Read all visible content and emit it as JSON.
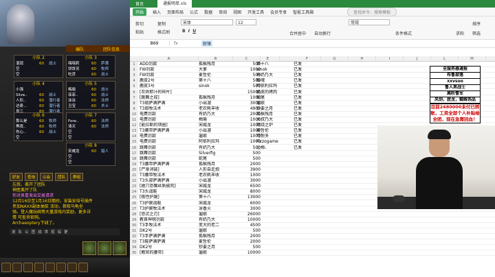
{
  "game": {
    "party_header": [
      "编队",
      "团队信息"
    ],
    "groups": [
      {
        "title": "小队 2",
        "rows": [
          [
            "混现",
            "60",
            "战士"
          ],
          [
            "空",
            "",
            ""
          ],
          [
            "空",
            "",
            ""
          ]
        ]
      },
      {
        "title": "小队 3",
        "rows": [
          [
            "嗨嗨莉",
            "60",
            "萨满"
          ],
          [
            "饼饼灵",
            "60",
            "牧师"
          ],
          [
            "吃货",
            "60",
            "战士"
          ]
        ]
      },
      {
        "title": "小队 4",
        "rows": [
          [
            "小强",
            "",
            ""
          ],
          [
            "Slive..",
            "60",
            "战士"
          ],
          [
            "人形..",
            "60",
            "潜行者"
          ],
          [
            "达奇...",
            "60",
            "潜行者"
          ],
          [
            "良三",
            "60",
            "潜行者"
          ]
        ]
      },
      {
        "title": "小队 5",
        "rows": [
          [
            "梅瑜",
            "60",
            "战士"
          ],
          [
            "菲菲..",
            "60",
            "战士"
          ],
          [
            "泳泳",
            "60",
            "法师"
          ],
          [
            "丑宝",
            "60",
            "术士"
          ]
        ]
      },
      {
        "title": "小队 6",
        "rows": [
          [
            "那么是",
            "60",
            "牧师"
          ],
          [
            "黑夜..",
            "60",
            "牧师"
          ],
          [
            "伤心..",
            "60",
            "战士"
          ],
          [
            "空",
            "",
            ""
          ]
        ]
      },
      {
        "title": "小队 7",
        "rows": [
          [
            "Fore..",
            "60",
            "法师"
          ],
          [
            "清天",
            "60",
            "法师"
          ],
          [
            "空",
            "",
            ""
          ],
          [
            "空",
            "",
            ""
          ]
        ]
      },
      {
        "title": "小队 8",
        "rows": [
          [
            "宋威龙",
            "60",
            "猎人"
          ],
          [
            "空",
            "",
            ""
          ],
          [
            "空",
            "",
            ""
          ]
        ]
      }
    ],
    "tabs": [
      "好友",
      "查询",
      "公会",
      "团队",
      "群组"
    ],
    "chat": [
      "忘我、离开了团队",
      "神医离开了队",
      "你对泉喜发出交易请求",
      "12月16日至1月16日期间，安装安培号插件",
      "参加NAXX副本抽奖 活动，首取马龟坐",
      "骑。登入魔玩碗等大量游戏内奖励，更多详",
      "情 可查询官网。",
      "Archaeoptery下线了。"
    ],
    "actionbar": [
      "说",
      "队",
      "公",
      "团",
      "战",
      "世",
      "招",
      "综",
      "更"
    ]
  },
  "excel": {
    "title_tab": "通报明单.xls",
    "home": "首页",
    "menu": [
      "开始",
      "插入",
      "页面布局",
      "公式",
      "数据",
      "审阅",
      "视图",
      "开发工具",
      "会员专享",
      "智能工具箱"
    ],
    "search": "查找命令、搜索模板",
    "ribbon": {
      "paste": "粘贴",
      "cut": "剪切",
      "copy": "复制",
      "format_painter": "格式刷",
      "font": "宋体",
      "size": "12",
      "merge": "合并居中",
      "wrap": "自动换行",
      "number_format": "常规",
      "conditional": "条件格式",
      "sum": "求和",
      "filter": "筛选",
      "sort": "排序"
    },
    "cell_ref": "B69",
    "fx": "fx",
    "formula_value": "斩锋",
    "columns": [
      "A",
      "B",
      "C",
      "D",
      "E",
      "F",
      "G",
      "H",
      "I",
      "J",
      "K",
      "L",
      "M"
    ],
    "rows": [
      {
        "n": "1",
        "a": "ADD罚款",
        "b": "孤枫残月",
        "c": "500",
        "e": "第十八",
        "f": "已发"
      },
      {
        "n": "2",
        "a": "FW罚款",
        "b": "大爹",
        "c": "1000",
        "e": "sinok",
        "f": "已发"
      },
      {
        "n": "3",
        "a": "FW罚款",
        "b": "麦哲伦",
        "c": "500",
        "e": "有奶乃大",
        "f": "已发"
      },
      {
        "n": "4",
        "a": "鹿皮2号",
        "b": "第十八",
        "c": "500",
        "e": "暖魂",
        "f": "已发"
      },
      {
        "n": "5",
        "a": "鹿皮3号",
        "b": "sinok",
        "c": "500",
        "e": "阿依利拉玛",
        "f": "已发"
      },
      {
        "n": "6",
        "a": "[灰烬耶汁的碎片]",
        "b": "",
        "c": "15000",
        "e": "脆皮的烤肉",
        "f": "已发"
      },
      {
        "n": "7",
        "a": "[跳舞之戒]",
        "b": "孤枫残月",
        "c": "1000",
        "e": "蛇尾",
        "f": "已发"
      },
      {
        "n": "8",
        "a": "T3肩萨满萨满",
        "b": "小出溜",
        "c": "3000",
        "e": "遛歌",
        "f": "已发"
      },
      {
        "n": "9",
        "a": "T3肩牧法术",
        "b": "老农耗丰收",
        "c": "4900",
        "e": "钞要之月",
        "f": "已发"
      },
      {
        "n": "10",
        "a": "电费罚款",
        "b": "有奶乃大",
        "c": "2000",
        "e": "孤枫残月",
        "f": "已发"
      },
      {
        "n": "11",
        "a": "电费罚款",
        "b": "梅瑜",
        "c": "1000",
        "e": "大叔乃大",
        "f": "已发"
      },
      {
        "n": "12",
        "a": "[能拉斯的项圈]",
        "b": "宋威龙",
        "c": "1000",
        "e": "燃烧之炉",
        "f": "已发"
      },
      {
        "n": "13",
        "a": "T3腰带萨满萨满",
        "b": "小出溜",
        "c": "1000",
        "e": "麦哲伦",
        "f": "已发"
      },
      {
        "n": "14",
        "a": "电费罚款",
        "b": "遛歌",
        "c": "1000",
        "e": "可耐多",
        "f": "已发"
      },
      {
        "n": "15",
        "a": "电费罚款",
        "b": "阿依利拉玛",
        "c": "1000",
        "e": "Fizzogame",
        "f": "已发"
      },
      {
        "n": "16",
        "a": "跳舞罚款",
        "b": "有奶乃大",
        "c": "500",
        "e": "尐梅、",
        "f": "已发"
      },
      {
        "n": "17",
        "a": "跳舞罚款",
        "b": "Silverfig",
        "c": "500",
        "e": "",
        "f": ""
      },
      {
        "n": "18",
        "a": "跳舞罚款",
        "b": "蛇尾",
        "c": "500",
        "e": "",
        "f": ""
      },
      {
        "n": "19",
        "a": "T3腰带萨满萨满",
        "b": "孤枫残月",
        "c": "2000",
        "e": "",
        "f": ""
      },
      {
        "n": "20",
        "a": "[尸身消链]",
        "b": "人形自走炮",
        "c": "3900",
        "e": "",
        "f": ""
      },
      {
        "n": "21",
        "a": "T3腰带牧法术",
        "b": "老农耗丰收",
        "c": "1000",
        "e": "",
        "f": ""
      },
      {
        "n": "22",
        "a": "T3头部萨满萨满",
        "b": "小出溜",
        "c": "3000",
        "e": "",
        "f": ""
      },
      {
        "n": "23",
        "a": "[她穴恐魔丝质披风]",
        "b": "宋威龙",
        "c": "6500",
        "e": "",
        "f": ""
      },
      {
        "n": "24",
        "a": "T3头战鞋",
        "b": "宋威龙",
        "c": "8000",
        "e": "",
        "f": ""
      },
      {
        "n": "25",
        "a": "[极性护腿]",
        "b": "第十八",
        "c": "13000",
        "e": "",
        "f": ""
      },
      {
        "n": "26",
        "a": "T3护腕战鞋",
        "b": "宋威龙",
        "c": "6000",
        "e": "",
        "f": ""
      },
      {
        "n": "27",
        "a": "T3护腕牧法术",
        "b": "泳香火",
        "c": "3000",
        "e": "",
        "f": ""
      },
      {
        "n": "28",
        "a": "[恐灵之刃]",
        "b": "遛歌",
        "c": "26000",
        "e": "",
        "f": ""
      },
      {
        "n": "29",
        "a": "教首神桃罚款",
        "b": "有奶乃大",
        "c": "10000",
        "e": "",
        "f": ""
      },
      {
        "n": "30",
        "a": "T3手牧法术",
        "b": "变大的老二",
        "c": "4500",
        "e": "",
        "f": ""
      },
      {
        "n": "31",
        "a": "DK2号",
        "b": "遛歌",
        "c": "500",
        "e": "",
        "f": ""
      },
      {
        "n": "32",
        "a": "T3手萨满萨满",
        "b": "孤枫残月",
        "c": "2000",
        "e": "",
        "f": ""
      },
      {
        "n": "33",
        "a": "T3鞋萨满萨满",
        "b": "麦哲伦",
        "c": "2000",
        "e": "",
        "f": ""
      },
      {
        "n": "34",
        "a": "DK2号",
        "b": "钞要之月",
        "c": "500",
        "e": "",
        "f": ""
      },
      {
        "n": "35",
        "a": "[教官的腰带]",
        "b": "遛歌",
        "c": "10000",
        "e": "",
        "f": ""
      }
    ],
    "notice": {
      "lines": [
        "全服务器通报",
        "布鲁部落",
        "xxvsoo",
        "鲁人男战士",
        "高阶督军",
        "风剑，屁龙，蜘蛛饰品"
      ],
      "red": "目前2480000未付已转账，工资全部个人补贴给全团，现在急需回血！"
    }
  }
}
